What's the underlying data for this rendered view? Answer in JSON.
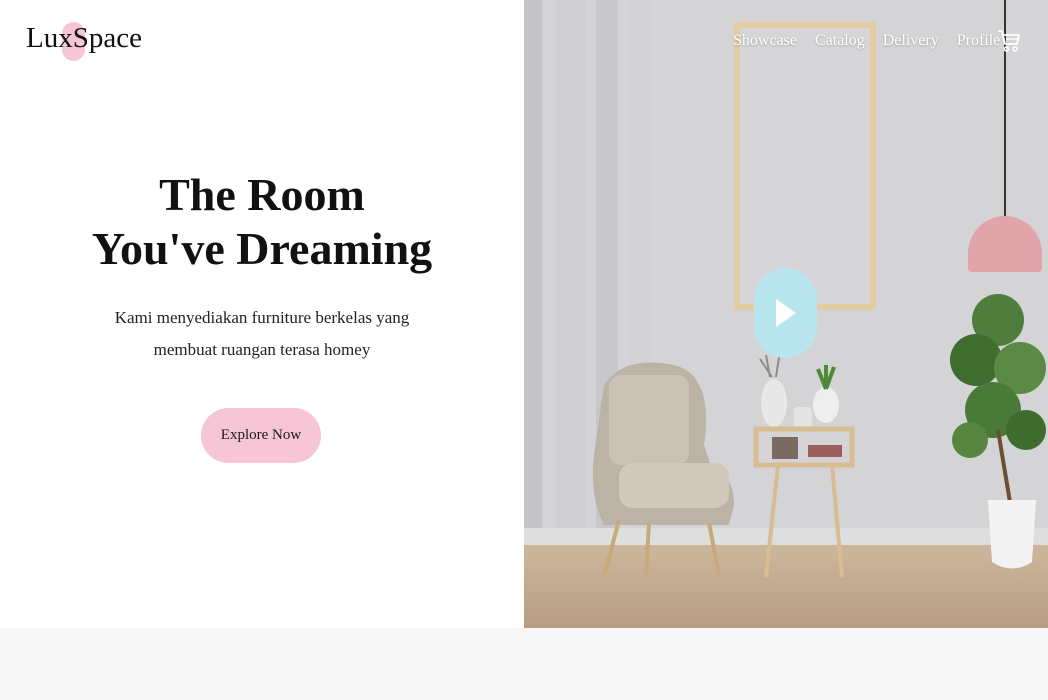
{
  "brand": {
    "name": "LuxSpace",
    "accent_color": "#f7c6d6"
  },
  "nav": {
    "items": [
      {
        "label": "Showcase"
      },
      {
        "label": "Catalog"
      },
      {
        "label": "Delivery"
      },
      {
        "label": "Profile"
      }
    ],
    "cart_icon": "cart-icon"
  },
  "hero": {
    "headline_line1": "The Room",
    "headline_line2": "You've Dreaming",
    "subtitle_line1": "Kami menyediakan furniture berkelas yang",
    "subtitle_line2": "membuat ruangan terasa homey",
    "cta_label": "Explore Now",
    "play_icon": "play-icon"
  },
  "colors": {
    "play_button": "#b9e6ee",
    "lamp": "#e2a4ab",
    "bottom_band": "#f7f7f7"
  }
}
